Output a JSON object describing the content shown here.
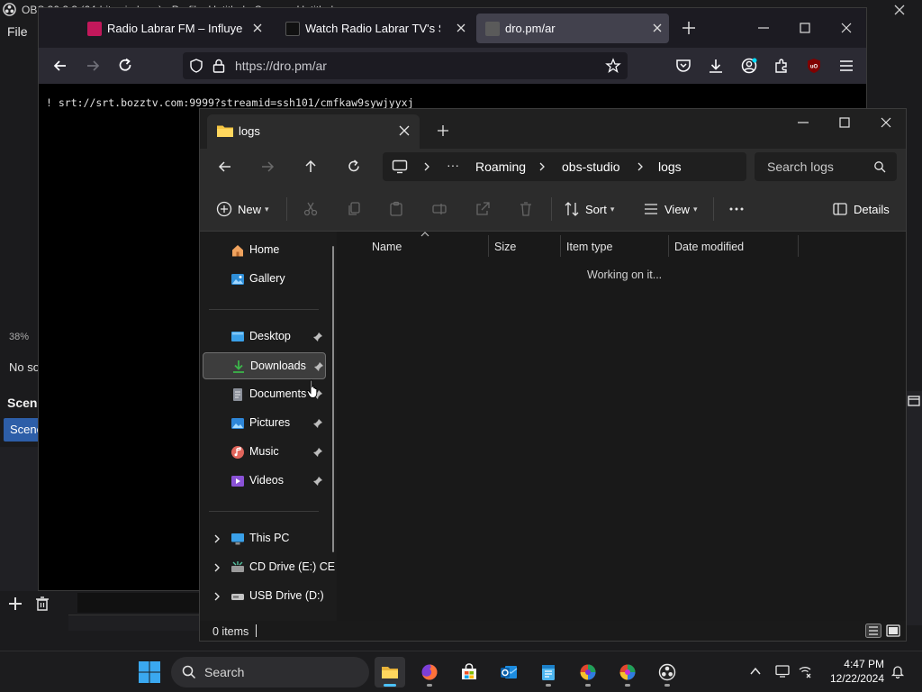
{
  "obs": {
    "title": "OBS 30.2.3 (64-bit, windows) - Profile: Untitled - Scenes: Untitled",
    "menu_file": "File",
    "zoom": "38%",
    "no_source": "No so",
    "scenes_title": "Scen",
    "scene_item": "Scene"
  },
  "firefox": {
    "tabs": [
      {
        "title": "Radio Labrar FM – Influye tus s",
        "color": "#c2185b"
      },
      {
        "title": "Watch Radio Labrar TV's Strea",
        "color": "#111111"
      },
      {
        "title": "dro.pm/ar",
        "color": "#5a5a5a"
      }
    ],
    "url": "https://dro.pm/ar",
    "page_text": "! srt://srt.bozztv.com:9999?streamid=ssh101/cmfkaw9sywjyyxj"
  },
  "explorer": {
    "tab_title": "logs",
    "breadcrumb": [
      "Roaming",
      "obs-studio",
      "logs"
    ],
    "search_placeholder": "Search logs",
    "toolbar": {
      "new_label": "New",
      "sort_label": "Sort",
      "view_label": "View",
      "details_label": "Details"
    },
    "nav": {
      "home": "Home",
      "gallery": "Gallery",
      "desktop": "Desktop",
      "downloads": "Downloads",
      "documents": "Documents",
      "pictures": "Pictures",
      "music": "Music",
      "videos": "Videos",
      "this_pc": "This PC",
      "cd_drive": "CD Drive (E:) CE",
      "usb_drive": "USB Drive (D:)"
    },
    "columns": [
      "Name",
      "Size",
      "Item type",
      "Date modified"
    ],
    "working_text": "Working on it...",
    "status": "0 items"
  },
  "taskbar": {
    "search_label": "Search",
    "time": "4:47 PM",
    "date": "12/22/2024"
  }
}
